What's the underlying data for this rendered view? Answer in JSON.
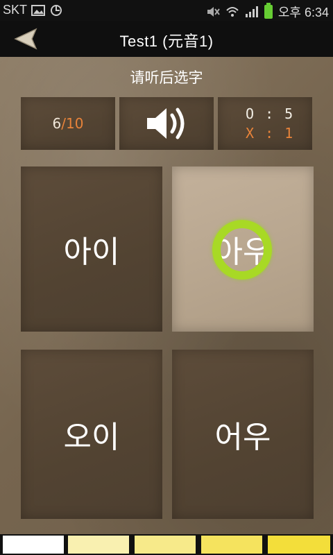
{
  "status_bar": {
    "carrier": "SKT",
    "time": "오후 6:34"
  },
  "header": {
    "title": "Test1 (元音1)"
  },
  "instruction": "请听后选字",
  "progress": {
    "current": "6",
    "separator": "/",
    "total": "10"
  },
  "score": {
    "correct": "O : 5",
    "wrong": "X : 1"
  },
  "answers": [
    {
      "label": "아이"
    },
    {
      "label": "아우"
    },
    {
      "label": "오이"
    },
    {
      "label": "어우"
    }
  ],
  "progress_strip": {
    "segments": 5,
    "colors": [
      "#ffffff",
      "#f9f0b0",
      "#f7ea8a",
      "#f5e35e",
      "#f3de3a"
    ]
  },
  "colors": {
    "accent": "#e8833a",
    "touch_ring": "#a8d925",
    "header_bg": "#0f0f0f"
  },
  "icons": {
    "back": "back-arrow-icon",
    "sound": "speaker-icon"
  }
}
